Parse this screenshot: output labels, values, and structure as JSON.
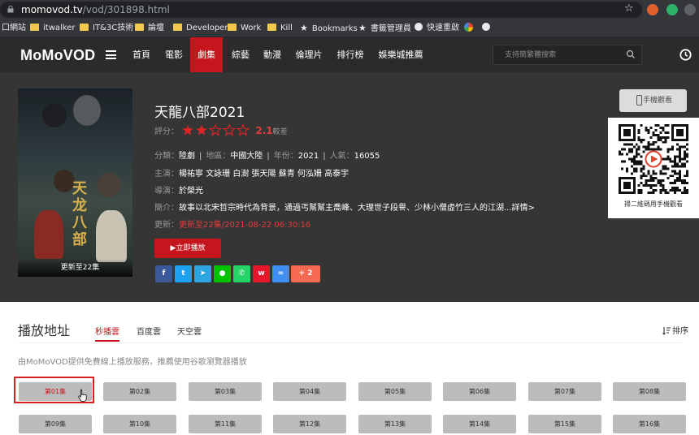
{
  "browser": {
    "url_host": "momovod.tv",
    "url_path": "/vod/301898.html",
    "bookmarks": [
      "口網站",
      "itwalker",
      "IT&3C技術",
      "論壇",
      "Developer",
      "Work",
      "Kill",
      "Bookmarks",
      "書籤管理員",
      "快速重啟"
    ]
  },
  "site": {
    "logo": "MoMoVOD",
    "nav": [
      "首頁",
      "電影",
      "劇集",
      "綜藝",
      "動漫",
      "倫理片",
      "排行榜",
      "娛樂城推薦"
    ],
    "active_nav": "劇集",
    "search_placeholder": "支持簡繁體搜索"
  },
  "show": {
    "title": "天龍八部2021",
    "rating_label": "評分：",
    "rating_value": 2.1,
    "rating_stars_filled": 2,
    "rating_stars_total": 5,
    "score_text": "2.1",
    "score_note": "較差",
    "category_label": "分類：",
    "category": "陸劇",
    "region_label": "地區：",
    "region": "中國大陸",
    "year_label": "年份：",
    "year": "2021",
    "popularity_label": "人氣：",
    "popularity": "16055",
    "cast_label": "主演：",
    "cast": "楊祐寧 文詠珊 白澍 張天陽 蘇青 何泓姍 高泰宇",
    "director_label": "導演：",
    "director": "於榮光",
    "synopsis_label": "簡介：",
    "synopsis": "故事以北宋哲宗時代為背景，通過丐幫幫主喬峰、大理世子段譽、少林小僧虛竹三人的江湖...詳情>",
    "updated_label": "更新：",
    "updated": "更新至22集/2021-08-22 06:30:16",
    "play_button": "▶立即播放",
    "poster_title": "天龙八部",
    "poster_badge": "更新至22集",
    "share_count": "2"
  },
  "mobile": {
    "button_label": "手機觀看",
    "qr_caption": "掃二維碼用手機觀看"
  },
  "episodes": {
    "section_title": "播放地址",
    "sources": [
      "秒播雲",
      "百度雲",
      "天空雲"
    ],
    "active_source": "秒播雲",
    "sort_label": "排序",
    "notice": "由MoMoVOD提供免費線上播放服務，推薦使用谷歌瀏覽器播放",
    "list": [
      "第01集",
      "第02集",
      "第03集",
      "第04集",
      "第05集",
      "第06集",
      "第07集",
      "第08集",
      "第09集",
      "第10集",
      "第11集",
      "第12集",
      "第13集",
      "第14集",
      "第15集",
      "第16集"
    ],
    "selected": "第01集"
  },
  "colors": {
    "accent": "#c4161c",
    "nav_bg": "#2b2b2b",
    "hero_bg": "#353535"
  }
}
